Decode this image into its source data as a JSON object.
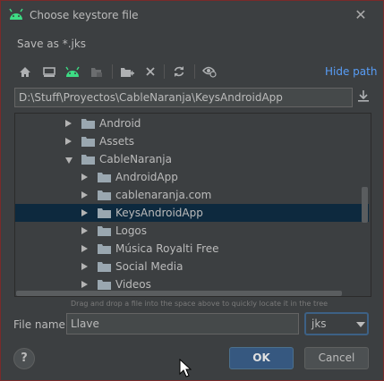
{
  "dialog": {
    "title": "Choose keystore file",
    "subtitle": "Save as *.jks",
    "close_glyph": "✕"
  },
  "toolbar": {
    "icons": [
      "home-icon",
      "desktop-icon",
      "android-icon",
      "module-icon",
      "new-folder-icon",
      "delete-icon",
      "refresh-icon",
      "show-hidden-icon"
    ],
    "hide_path_label": "Hide path"
  },
  "path": {
    "value": "D:\\Stuff\\Proyectos\\CableNaranja\\KeysAndroidApp"
  },
  "tree": {
    "items": [
      {
        "label": "Android",
        "depth": 0,
        "expanded": false,
        "selected": false
      },
      {
        "label": "Assets",
        "depth": 0,
        "expanded": false,
        "selected": false
      },
      {
        "label": "CableNaranja",
        "depth": 0,
        "expanded": true,
        "selected": false
      },
      {
        "label": "AndroidApp",
        "depth": 1,
        "expanded": false,
        "selected": false
      },
      {
        "label": "cablenaranja.com",
        "depth": 1,
        "expanded": false,
        "selected": false
      },
      {
        "label": "KeysAndroidApp",
        "depth": 1,
        "expanded": false,
        "selected": true
      },
      {
        "label": "Logos",
        "depth": 1,
        "expanded": false,
        "selected": false
      },
      {
        "label": "Música Royalti Free",
        "depth": 1,
        "expanded": false,
        "selected": false
      },
      {
        "label": "Social Media",
        "depth": 1,
        "expanded": false,
        "selected": false
      },
      {
        "label": "Videos",
        "depth": 1,
        "expanded": false,
        "selected": false
      }
    ]
  },
  "hint": "Drag and drop a file into the space above to quickly locate it in the tree",
  "file_name": {
    "label": "File name:",
    "value": "Llave"
  },
  "extension": {
    "selected": "jks"
  },
  "buttons": {
    "help": "?",
    "ok": "OK",
    "cancel": "Cancel"
  },
  "colors": {
    "background": "#3c3f41",
    "selection": "#0d293e",
    "accent_link": "#589df6",
    "android_green": "#3ddc84",
    "ok_button": "#365880"
  }
}
